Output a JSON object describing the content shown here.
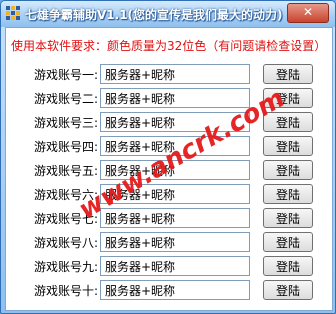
{
  "window": {
    "title": "七雄争霸辅助V1.1(您的宣传是我们最大的动力)",
    "close_label": "✕"
  },
  "requirement": "使用本软件要求：颜色质量为32位色（有问题请检查设置）",
  "accounts": [
    {
      "label": "游戏账号一:",
      "value": "服务器+昵称",
      "button": "登陆"
    },
    {
      "label": "游戏账号二:",
      "value": "服务器+昵称",
      "button": "登陆"
    },
    {
      "label": "游戏账号三:",
      "value": "服务器+昵称",
      "button": "登陆"
    },
    {
      "label": "游戏账号四:",
      "value": "服务器+昵称",
      "button": "登陆"
    },
    {
      "label": "游戏账号五:",
      "value": "服务器+昵称",
      "button": "登陆"
    },
    {
      "label": "游戏账号六:",
      "value": "服务器+昵称",
      "button": "登陆"
    },
    {
      "label": "游戏账号七:",
      "value": "服务器+昵称",
      "button": "登陆"
    },
    {
      "label": "游戏账号八:",
      "value": "服务器+昵称",
      "button": "登陆"
    },
    {
      "label": "游戏账号九:",
      "value": "服务器+昵称",
      "button": "登陆"
    },
    {
      "label": "游戏账号十:",
      "value": "服务器+昵称",
      "button": "登陆"
    }
  ],
  "watermark": "www.ancrk.com",
  "colors": {
    "title_bar": "#a9d0f5",
    "requirement_text": "#e01010",
    "watermark": "#e51b1b"
  },
  "icons": {
    "app": "app-grid-icon",
    "close": "close-icon"
  }
}
